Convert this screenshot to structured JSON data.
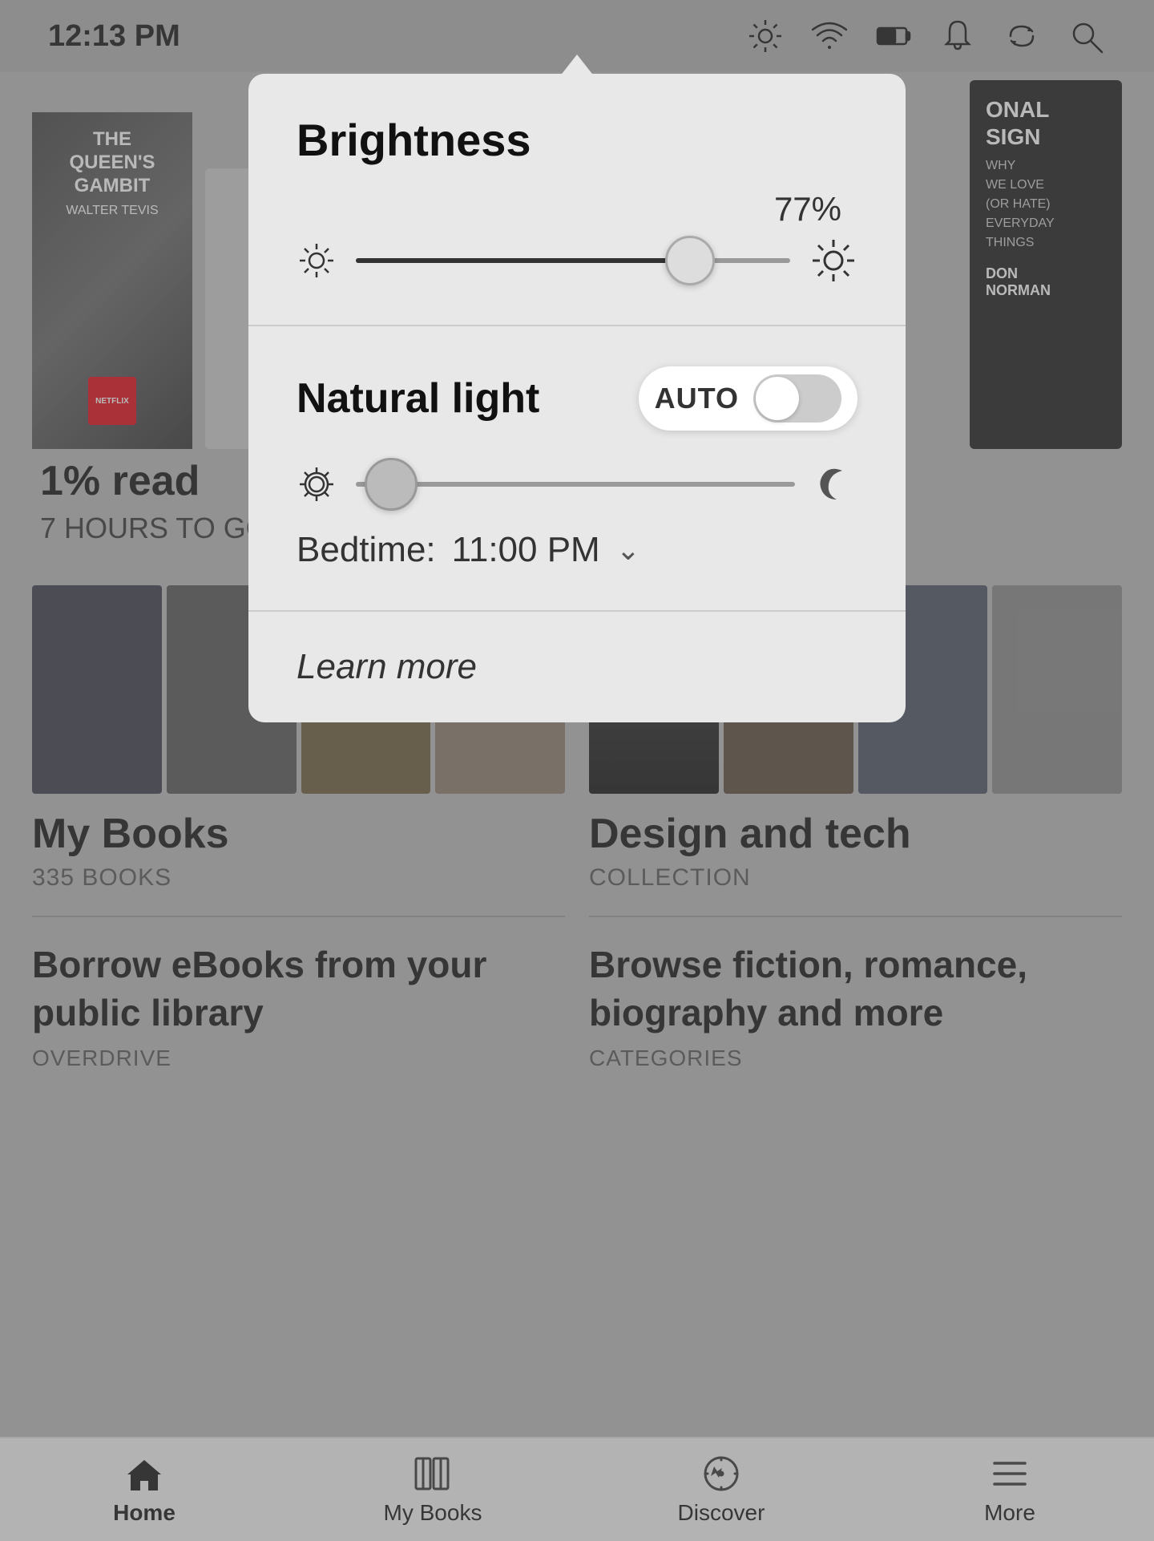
{
  "statusBar": {
    "time": "12:13 PM"
  },
  "brightnessPanel": {
    "title": "Brightness",
    "percent": "77%",
    "sliderValue": 77,
    "naturalLight": {
      "label": "Natural light",
      "toggleLabel": "AUTO",
      "isOn": false,
      "sliderValue": 8,
      "bedtime": {
        "label": "Bedtime:",
        "time": "11:00 PM"
      }
    },
    "learnMore": "Learn more"
  },
  "mainContent": {
    "book1": {
      "title": "The Queen's Gambit",
      "author": "Walter Tevis",
      "progress": "1% read",
      "timeLeft": "7 HOURS TO GO"
    },
    "myBooks": {
      "title": "My Books",
      "count": "335 BOOKS"
    },
    "designTech": {
      "title": "Design and tech",
      "type": "COLLECTION"
    },
    "promo1": {
      "title": "Borrow eBooks from your public library",
      "type": "OVERDRIVE"
    },
    "promo2": {
      "title": "Browse fiction, romance, biography and more",
      "type": "CATEGORIES"
    }
  },
  "bottomNav": {
    "items": [
      {
        "label": "Home",
        "active": true
      },
      {
        "label": "My Books",
        "active": false
      },
      {
        "label": "Discover",
        "active": false
      },
      {
        "label": "More",
        "active": false
      }
    ]
  }
}
